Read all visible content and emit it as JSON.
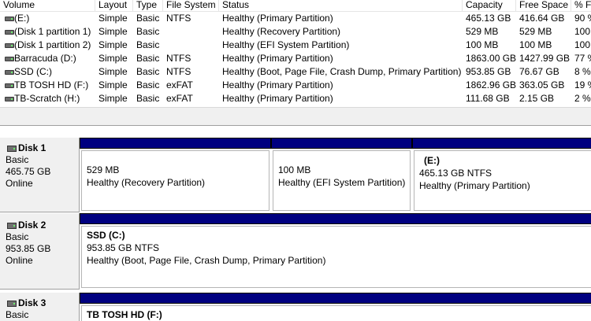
{
  "volumes": {
    "columns": [
      "Volume",
      "Layout",
      "Type",
      "File System",
      "Status",
      "Capacity",
      "Free Space",
      "% F"
    ],
    "rows": [
      {
        "volume": "(E:)",
        "layout": "Simple",
        "type": "Basic",
        "fs": "NTFS",
        "status": "Healthy (Primary Partition)",
        "capacity": "465.13 GB",
        "free": "416.64 GB",
        "pct": "90 %"
      },
      {
        "volume": "(Disk 1 partition 1)",
        "layout": "Simple",
        "type": "Basic",
        "fs": "",
        "status": "Healthy (Recovery Partition)",
        "capacity": "529 MB",
        "free": "529 MB",
        "pct": "100"
      },
      {
        "volume": "(Disk 1 partition 2)",
        "layout": "Simple",
        "type": "Basic",
        "fs": "",
        "status": "Healthy (EFI System Partition)",
        "capacity": "100 MB",
        "free": "100 MB",
        "pct": "100"
      },
      {
        "volume": "Barracuda (D:)",
        "layout": "Simple",
        "type": "Basic",
        "fs": "NTFS",
        "status": "Healthy (Primary Partition)",
        "capacity": "1863.00 GB",
        "free": "1427.99 GB",
        "pct": "77 %"
      },
      {
        "volume": "SSD (C:)",
        "layout": "Simple",
        "type": "Basic",
        "fs": "NTFS",
        "status": "Healthy (Boot, Page File, Crash Dump, Primary Partition)",
        "capacity": "953.85 GB",
        "free": "76.67 GB",
        "pct": "8 %"
      },
      {
        "volume": "TB TOSH HD (F:)",
        "layout": "Simple",
        "type": "Basic",
        "fs": "exFAT",
        "status": "Healthy (Primary Partition)",
        "capacity": "1862.96 GB",
        "free": "363.05 GB",
        "pct": "19 %"
      },
      {
        "volume": "TB-Scratch (H:)",
        "layout": "Simple",
        "type": "Basic",
        "fs": "exFAT",
        "status": "Healthy (Primary Partition)",
        "capacity": "111.68 GB",
        "free": "2.15 GB",
        "pct": "2 %"
      }
    ]
  },
  "disks": [
    {
      "title": "Disk 1",
      "type": "Basic",
      "size": "465.75 GB",
      "state": "Online",
      "partitions": [
        {
          "name": "",
          "size": "529 MB",
          "status": "Healthy (Recovery Partition)"
        },
        {
          "name": "",
          "size": "100 MB",
          "status": "Healthy (EFI System Partition)"
        },
        {
          "name": "(E:)",
          "size": "465.13 GB NTFS",
          "status": "Healthy (Primary Partition)"
        }
      ]
    },
    {
      "title": "Disk 2",
      "type": "Basic",
      "size": "953.85 GB",
      "state": "Online",
      "partitions": [
        {
          "name": "SSD  (C:)",
          "size": "953.85 GB NTFS",
          "status": "Healthy (Boot, Page File, Crash Dump, Primary Partition)"
        }
      ]
    },
    {
      "title": "Disk 3",
      "type": "Basic",
      "size": "",
      "state": "",
      "partitions": [
        {
          "name": "TB TOSH HD  (F:)",
          "size": "",
          "status": ""
        }
      ]
    }
  ],
  "colors": {
    "partition_bar": "#000080",
    "disk_info_bg": "#f0f0f0",
    "splitter_bg": "#f0f0f0"
  }
}
